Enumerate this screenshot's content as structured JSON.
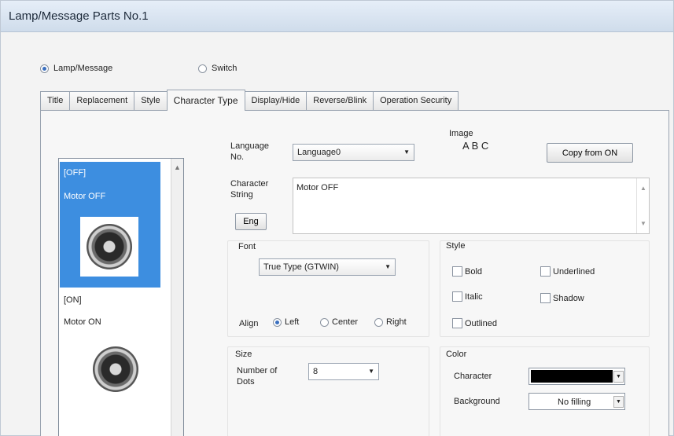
{
  "window": {
    "title": "Lamp/Message Parts No.1"
  },
  "mode": {
    "lamp_message_label": "Lamp/Message",
    "switch_label": "Switch",
    "selected": "lamp_message"
  },
  "tabs": [
    {
      "label": "Title"
    },
    {
      "label": "Replacement"
    },
    {
      "label": "Style"
    },
    {
      "label": "Character Type",
      "active": true
    },
    {
      "label": "Display/Hide"
    },
    {
      "label": "Reverse/Blink"
    },
    {
      "label": "Operation Security"
    }
  ],
  "state_list": {
    "items": [
      {
        "state": "[OFF]",
        "text": "Motor OFF",
        "selected": true
      },
      {
        "state": "[ON]",
        "text": "Motor ON",
        "selected": false
      }
    ]
  },
  "language": {
    "label": "Language No.",
    "value": "Language0"
  },
  "image": {
    "label": "Image",
    "preview": "A B C"
  },
  "copy_button": {
    "label": "Copy from ON"
  },
  "character_string": {
    "label": "Character String",
    "value": "Motor OFF",
    "eng_button": "Eng"
  },
  "font": {
    "label": "Font",
    "value": "True Type (GTWIN)",
    "align_label": "Align",
    "align_options": [
      "Left",
      "Center",
      "Right"
    ],
    "align_selected": "Left"
  },
  "style": {
    "label": "Style",
    "options": [
      {
        "label": "Bold",
        "checked": false
      },
      {
        "label": "Underlined",
        "checked": false
      },
      {
        "label": "Italic",
        "checked": false
      },
      {
        "label": "Shadow",
        "checked": false
      },
      {
        "label": "Outlined",
        "checked": false
      }
    ]
  },
  "size": {
    "label": "Size",
    "dots_label": "Number of Dots",
    "dots_value": "8"
  },
  "color": {
    "label": "Color",
    "character_label": "Character",
    "character_value": "#000000",
    "background_label": "Background",
    "background_value": "No filling"
  }
}
